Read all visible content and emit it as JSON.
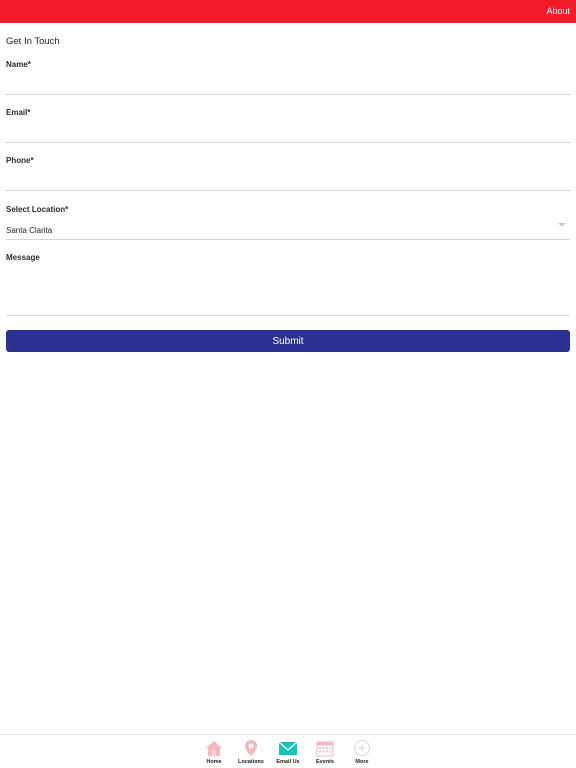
{
  "header": {
    "about_label": "About",
    "accent_color": "#f21c2a"
  },
  "form": {
    "title": "Get In Touch",
    "name_label": "Name*",
    "email_label": "Email*",
    "phone_label": "Phone*",
    "location_label": "Select Location*",
    "location_value": "Santa Clarita",
    "message_label": "Message",
    "submit_label": "Submit",
    "submit_color": "#2b3190"
  },
  "tabbar": {
    "items": [
      {
        "label": "Home",
        "icon": "home-icon"
      },
      {
        "label": "Locations",
        "icon": "location-pin-icon"
      },
      {
        "label": "Email Us",
        "icon": "envelope-icon",
        "active": true
      },
      {
        "label": "Events",
        "icon": "calendar-icon"
      },
      {
        "label": "More",
        "icon": "plus-circle-icon"
      }
    ]
  }
}
